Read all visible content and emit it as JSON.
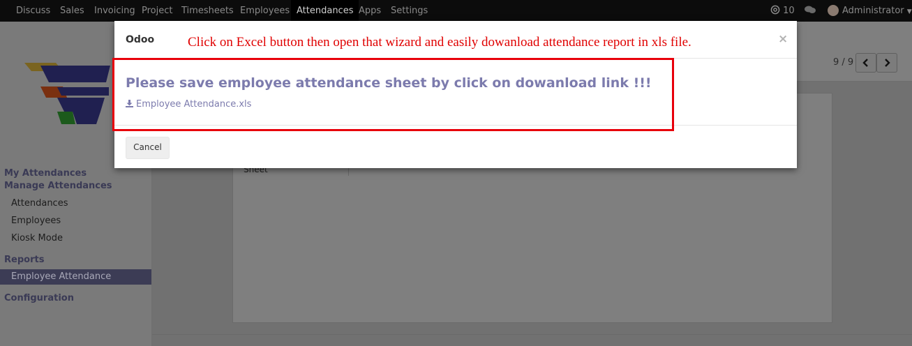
{
  "navbar": {
    "items": [
      "Discuss",
      "Sales",
      "Invoicing",
      "Project",
      "Timesheets",
      "Employees",
      "Attendances",
      "Apps",
      "Settings"
    ],
    "active": "Attendances",
    "messages_count": "10",
    "user": "Administrator"
  },
  "sidebar": {
    "my_attendances": "My Attendances",
    "manage_attendances": "Manage Attendances",
    "attendances": "Attendances",
    "employees": "Employees",
    "kiosk_mode": "Kiosk Mode",
    "reports": "Reports",
    "employee_attendance": "Employee Attendance",
    "configuration": "Configuration"
  },
  "pager": {
    "value": "9 / 9"
  },
  "sheet": {
    "label": "Sheet"
  },
  "modal": {
    "title": "Odoo",
    "close_symbol": "×",
    "annotation": "Click on Excel button then open that wizard and easily dowanload attendance report in xls file.",
    "body_title": "Please save employee attendance sheet by click on dowanload link !!!",
    "download_link": "Employee Attendance.xls",
    "cancel_label": "Cancel"
  },
  "colors": {
    "accent": "#7c7bad",
    "annotation_red": "#e00000",
    "navbar_bg": "#0c0c0c"
  }
}
